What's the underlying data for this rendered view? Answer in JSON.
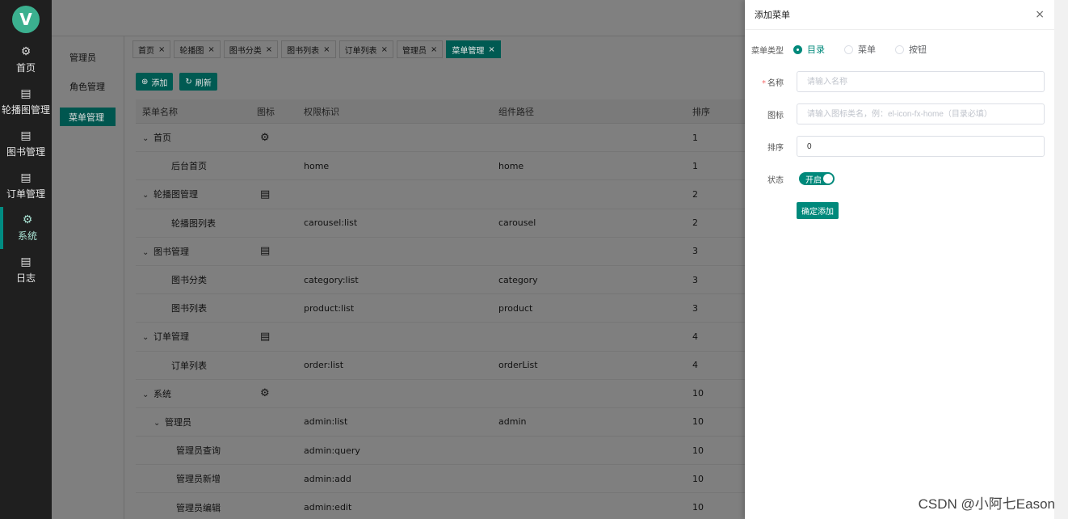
{
  "rail": {
    "logo": "V",
    "items": [
      {
        "label": "首页",
        "icon": "gear-icon"
      },
      {
        "label": "轮播图管理",
        "icon": "clipboard-icon"
      },
      {
        "label": "图书管理",
        "icon": "clipboard-icon"
      },
      {
        "label": "订单管理",
        "icon": "clipboard-icon"
      },
      {
        "label": "系统",
        "icon": "gear-icon"
      },
      {
        "label": "日志",
        "icon": "clipboard-icon"
      }
    ]
  },
  "subnav": {
    "items": [
      "管理员",
      "角色管理",
      "菜单管理"
    ]
  },
  "tabs": [
    "首页",
    "轮播图",
    "图书分类",
    "图书列表",
    "订单列表",
    "管理员",
    "菜单管理"
  ],
  "actions": {
    "add": "添加",
    "refresh": "刷新"
  },
  "table": {
    "headers": [
      "菜单名称",
      "图标",
      "权限标识",
      "组件路径",
      "排序"
    ],
    "rows": [
      {
        "name": "首页",
        "icon": "gear",
        "perm": "",
        "path": "",
        "sort": "1",
        "level": 0,
        "expand": true
      },
      {
        "name": "后台首页",
        "icon": "",
        "perm": "home",
        "path": "home",
        "sort": "1",
        "level": 1,
        "expand": false
      },
      {
        "name": "轮播图管理",
        "icon": "clipboard",
        "perm": "",
        "path": "",
        "sort": "2",
        "level": 0,
        "expand": true
      },
      {
        "name": "轮播图列表",
        "icon": "",
        "perm": "carousel:list",
        "path": "carousel",
        "sort": "2",
        "level": 1,
        "expand": false
      },
      {
        "name": "图书管理",
        "icon": "clipboard",
        "perm": "",
        "path": "",
        "sort": "3",
        "level": 0,
        "expand": true
      },
      {
        "name": "图书分类",
        "icon": "",
        "perm": "category:list",
        "path": "category",
        "sort": "3",
        "level": 1,
        "expand": false
      },
      {
        "name": "图书列表",
        "icon": "",
        "perm": "product:list",
        "path": "product",
        "sort": "3",
        "level": 1,
        "expand": false
      },
      {
        "name": "订单管理",
        "icon": "clipboard",
        "perm": "",
        "path": "",
        "sort": "4",
        "level": 0,
        "expand": true
      },
      {
        "name": "订单列表",
        "icon": "",
        "perm": "order:list",
        "path": "orderList",
        "sort": "4",
        "level": 1,
        "expand": false
      },
      {
        "name": "系统",
        "icon": "gear",
        "perm": "",
        "path": "",
        "sort": "10",
        "level": 0,
        "expand": true
      },
      {
        "name": "管理员",
        "icon": "",
        "perm": "admin:list",
        "path": "admin",
        "sort": "10",
        "level": 1,
        "expand": true
      },
      {
        "name": "管理员查询",
        "icon": "",
        "perm": "admin:query",
        "path": "",
        "sort": "10",
        "level": 2,
        "expand": false
      },
      {
        "name": "管理员新增",
        "icon": "",
        "perm": "admin:add",
        "path": "",
        "sort": "10",
        "level": 2,
        "expand": false
      },
      {
        "name": "管理员编辑",
        "icon": "",
        "perm": "admin:edit",
        "path": "",
        "sort": "10",
        "level": 2,
        "expand": false
      }
    ]
  },
  "drawer": {
    "title": "添加菜单",
    "type_label": "菜单类型",
    "type_options": [
      "目录",
      "菜单",
      "按钮"
    ],
    "type_selected": "目录",
    "name_label": "名称",
    "name_placeholder": "请输入名称",
    "icon_label": "图标",
    "icon_placeholder": "请输入图标类名，例：el-icon-fx-home（目录必填）",
    "sort_label": "排序",
    "sort_value": "0",
    "status_label": "状态",
    "status_on_text": "开启",
    "submit_label": "确定添加"
  },
  "watermark": "CSDN @小阿七Eason"
}
